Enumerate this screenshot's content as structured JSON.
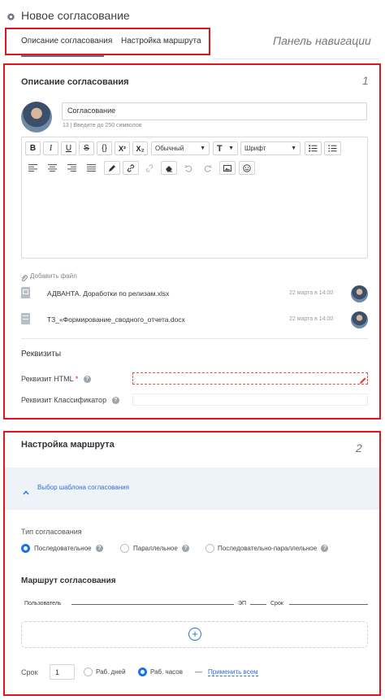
{
  "header": {
    "title": "Новое согласование"
  },
  "tabs": [
    {
      "label": "Описание согласования",
      "active": true
    },
    {
      "label": "Настройка маршрута",
      "active": false
    }
  ],
  "nav_annotation": "Панель навигации",
  "section1": {
    "heading": "Описание согласования",
    "number": "1",
    "name_value": "Согласование",
    "name_hint": "13 | Введите до 250 символов",
    "toolbar": {
      "bold": "B",
      "italic": "I",
      "underline": "U",
      "strike": "S",
      "code": "{}",
      "superscript": "X²",
      "subscript": "X₂",
      "format_select": "Обычный",
      "text_size": "T",
      "font_select": "Шрифт"
    },
    "add_file": "Добавить файл",
    "files": [
      {
        "name": "АДВАНТА. Доработки по релизам.xlsx",
        "date": "22 марта в 14:00"
      },
      {
        "name": "ТЗ_«Формирование_сводного_отчета.docx",
        "date": "22 марта в 14:00"
      }
    ],
    "requisites": {
      "heading": "Реквизиты",
      "html_label": "Реквизит HTML",
      "required_mark": "*",
      "classifier_label": "Реквизит Классификатор"
    }
  },
  "section2": {
    "heading": "Настройка маршрута",
    "number": "2",
    "template_link": "Выбор шаблона согласования",
    "type_label": "Тип согласования",
    "types": [
      {
        "label": "Последовательное",
        "selected": true
      },
      {
        "label": "Параллельное",
        "selected": false
      },
      {
        "label": "Последовательно-параллельное",
        "selected": false
      }
    ],
    "route_heading": "Маршрут согласования",
    "columns": {
      "user": "Пользователь",
      "ep": "ЭП",
      "deadline": "Срок"
    },
    "add_symbol": "+",
    "deadline_label": "Срок",
    "deadline_value": "1",
    "deadline_units": [
      {
        "label": "Раб. дней",
        "selected": false
      },
      {
        "label": "Раб. часов",
        "selected": true
      }
    ],
    "dash": "—",
    "apply_all": "Применить всем"
  },
  "colors": {
    "accent": "#1a73e8",
    "annotation_red": "#e3141b",
    "tab_underline": "#5b6f8f"
  }
}
